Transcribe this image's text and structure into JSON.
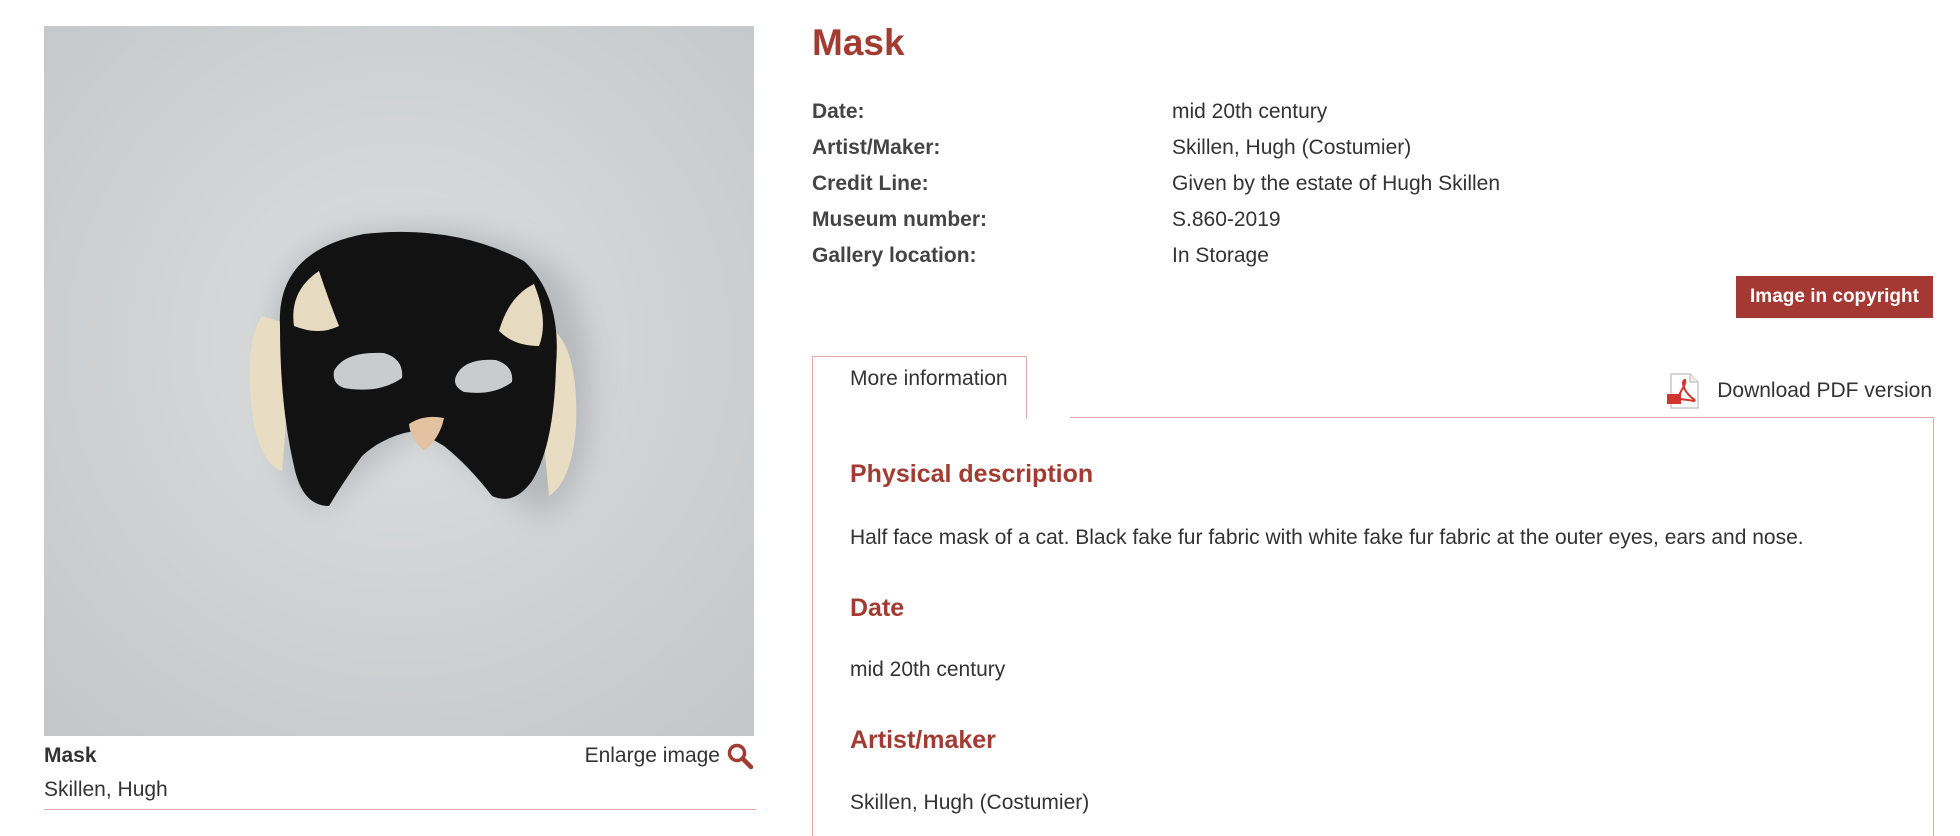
{
  "object": {
    "title": "Mask",
    "caption_title": "Mask",
    "caption_maker": "Skillen, Hugh",
    "enlarge_label": "Enlarge image"
  },
  "metadata": [
    {
      "label": "Date:",
      "value": "mid 20th century"
    },
    {
      "label": "Artist/Maker:",
      "value": "Skillen, Hugh (Costumier)"
    },
    {
      "label": "Credit Line:",
      "value": "Given by the estate of Hugh Skillen"
    },
    {
      "label": "Museum number:",
      "value": "S.860-2019"
    },
    {
      "label": "Gallery location:",
      "value": "In Storage"
    }
  ],
  "copyright_label": "Image in copyright",
  "tabs": {
    "more_info": "More information",
    "pdf_label": "Download PDF version"
  },
  "sections": {
    "physical_heading": "Physical description",
    "physical_text": "Half face mask of a cat. Black fake fur fabric with white fake fur fabric at the outer eyes, ears and nose.",
    "date_heading": "Date",
    "date_text": "mid 20th century",
    "artist_heading": "Artist/maker",
    "artist_text": "Skillen, Hugh (Costumier)"
  },
  "colors": {
    "accent": "#a23b32",
    "divider": "#e3a9a5"
  },
  "icons": [
    "magnifier-icon",
    "pdf-icon"
  ]
}
